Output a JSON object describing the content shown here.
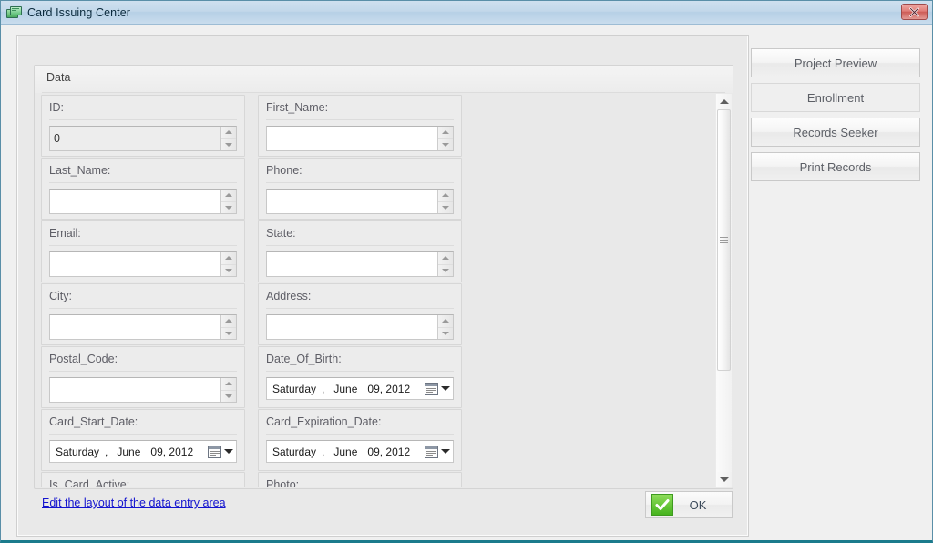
{
  "window": {
    "title": "Card Issuing Center",
    "icon": "cards-icon",
    "close_label": "Close"
  },
  "panel": {
    "groupbox_title": "Data",
    "edit_layout_link": "Edit the layout of the data entry area",
    "ok_label": "OK"
  },
  "fields": [
    [
      {
        "label": "ID:",
        "value": "0",
        "control": "spinner",
        "readonly": true
      },
      {
        "label": "First_Name:",
        "value": "",
        "control": "spinner",
        "readonly": false
      }
    ],
    [
      {
        "label": "Last_Name:",
        "value": "",
        "control": "spinner",
        "readonly": false
      },
      {
        "label": "Phone:",
        "value": "",
        "control": "spinner",
        "readonly": false
      }
    ],
    [
      {
        "label": "Email:",
        "value": "",
        "control": "spinner",
        "readonly": false
      },
      {
        "label": "State:",
        "value": "",
        "control": "spinner",
        "readonly": false
      }
    ],
    [
      {
        "label": "City:",
        "value": "",
        "control": "spinner",
        "readonly": false
      },
      {
        "label": "Address:",
        "value": "",
        "control": "spinner",
        "readonly": false
      }
    ],
    [
      {
        "label": "Postal_Code:",
        "value": "",
        "control": "spinner",
        "readonly": false
      },
      {
        "label": "Date_Of_Birth:",
        "control": "date",
        "date": {
          "day": "Saturday",
          "comma": ",",
          "month": "June",
          "date": "09, 2012"
        }
      }
    ],
    [
      {
        "label": "Card_Start_Date:",
        "control": "date",
        "date": {
          "day": "Saturday",
          "comma": ",",
          "month": "June",
          "date": "09, 2012"
        }
      },
      {
        "label": "Card_Expiration_Date:",
        "control": "date",
        "date": {
          "day": "Saturday",
          "comma": ",",
          "month": "June",
          "date": "09, 2012"
        }
      }
    ],
    [
      {
        "label": "Is_Card_Active:",
        "control": "clipped"
      },
      {
        "label": "Photo:",
        "control": "clipped"
      }
    ]
  ],
  "side_buttons": [
    {
      "label": "Project Preview",
      "active": false
    },
    {
      "label": "Enrollment",
      "active": true
    },
    {
      "label": "Records Seeker",
      "active": false
    },
    {
      "label": "Print Records",
      "active": false
    }
  ],
  "scrollbar": {
    "up_arrow": "scroll-up-icon",
    "down_arrow": "scroll-down-icon",
    "thumb_top_percent": 0,
    "thumb_height_percent": 72
  },
  "colors": {
    "title_bar": "#c2d8ea",
    "link": "#1414cf",
    "ok_check": "#46b31e",
    "close_button": "#cd5c57"
  }
}
